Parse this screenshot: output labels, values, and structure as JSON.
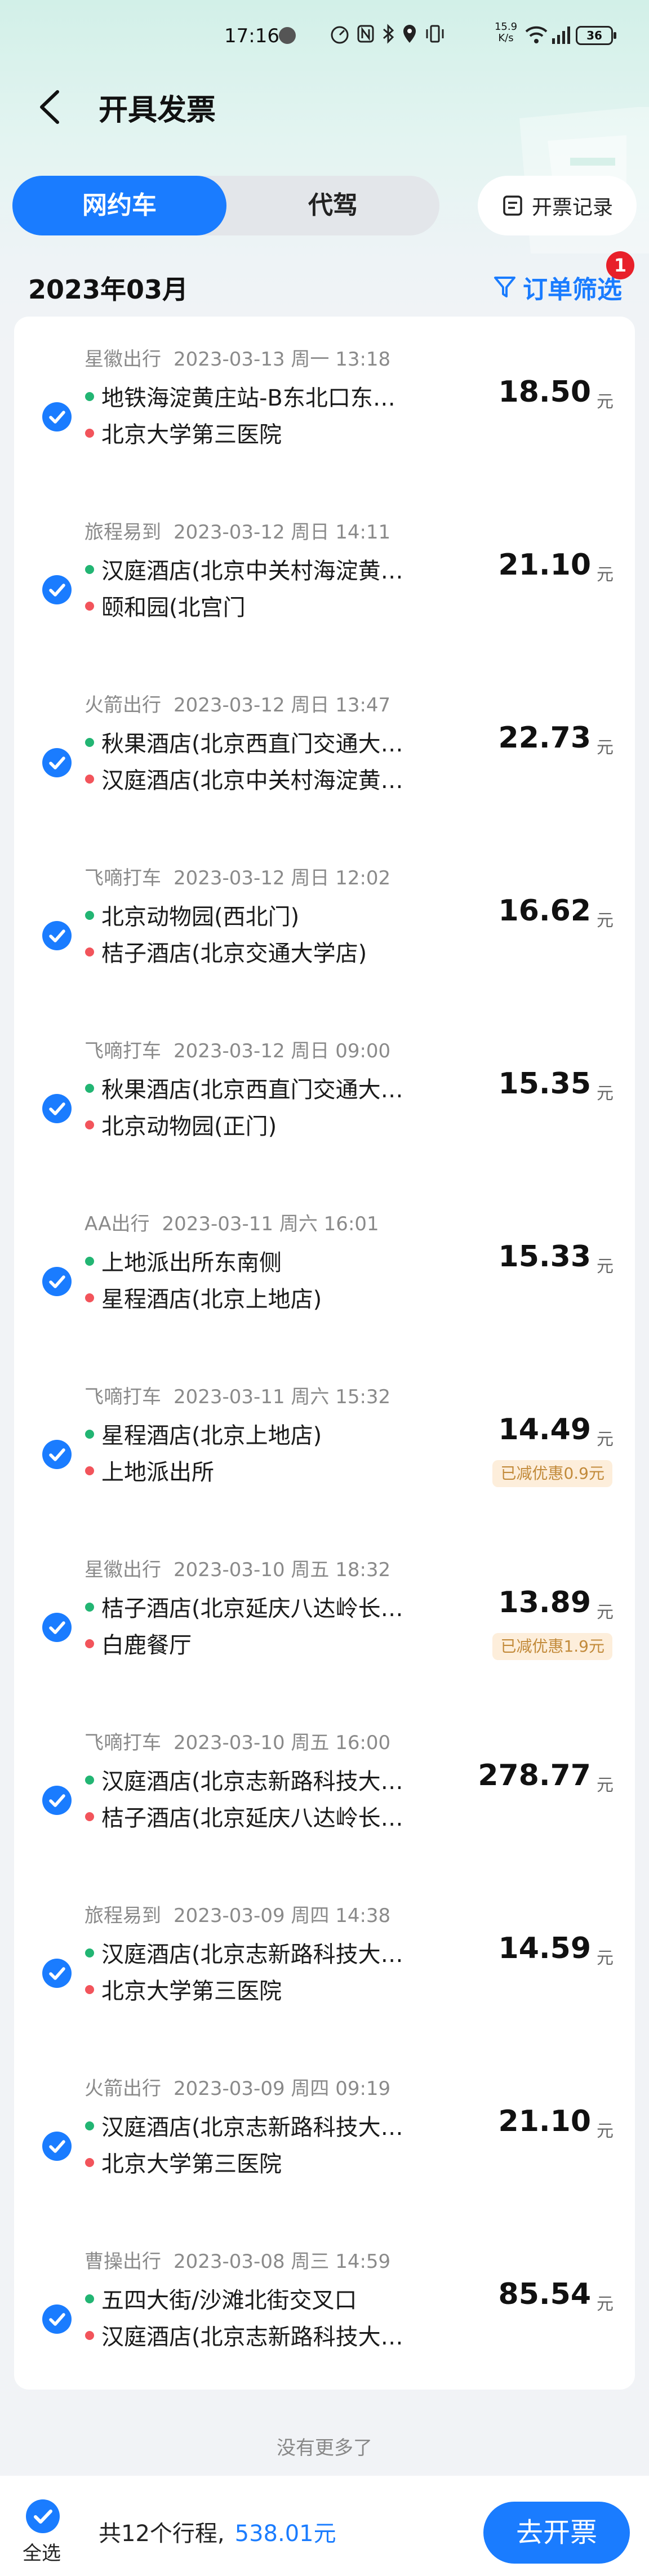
{
  "status_bar": {
    "time": "17:16",
    "net_speed_value": "15.9",
    "net_speed_unit": "K/s",
    "battery": "36"
  },
  "nav": {
    "title": "开具发票"
  },
  "tabs": [
    {
      "label": "网约车",
      "active": true
    },
    {
      "label": "代驾",
      "active": false
    }
  ],
  "invoice_records_label": "开票记录",
  "month": "2023年03月",
  "filter": {
    "label": "订单筛选",
    "badge": "1"
  },
  "trips": [
    {
      "provider": "星徽出行",
      "datetime": "2023-03-13 周一 13:18",
      "from": "地铁海淀黄庄站-B东北口东…",
      "to": "北京大学第三医院",
      "price": "18.50",
      "discount": ""
    },
    {
      "provider": "旅程易到",
      "datetime": "2023-03-12 周日 14:11",
      "from": "汉庭酒店(北京中关村海淀黄…",
      "to": "颐和园(北宫门",
      "price": "21.10",
      "discount": ""
    },
    {
      "provider": "火箭出行",
      "datetime": "2023-03-12 周日 13:47",
      "from": "秋果酒店(北京西直门交通大…",
      "to": "汉庭酒店(北京中关村海淀黄…",
      "price": "22.73",
      "discount": ""
    },
    {
      "provider": "飞嘀打车",
      "datetime": "2023-03-12 周日 12:02",
      "from": "北京动物园(西北门)",
      "to": "桔子酒店(北京交通大学店)",
      "price": "16.62",
      "discount": ""
    },
    {
      "provider": "飞嘀打车",
      "datetime": "2023-03-12 周日 09:00",
      "from": "秋果酒店(北京西直门交通大…",
      "to": "北京动物园(正门)",
      "price": "15.35",
      "discount": ""
    },
    {
      "provider": "AA出行",
      "datetime": "2023-03-11 周六 16:01",
      "from": "上地派出所东南侧",
      "to": "星程酒店(北京上地店)",
      "price": "15.33",
      "discount": ""
    },
    {
      "provider": "飞嘀打车",
      "datetime": "2023-03-11 周六 15:32",
      "from": "星程酒店(北京上地店)",
      "to": "上地派出所",
      "price": "14.49",
      "discount": "已减优惠0.9元"
    },
    {
      "provider": "星徽出行",
      "datetime": "2023-03-10 周五 18:32",
      "from": "桔子酒店(北京延庆八达岭长…",
      "to": "白鹿餐厅",
      "price": "13.89",
      "discount": "已减优惠1.9元"
    },
    {
      "provider": "飞嘀打车",
      "datetime": "2023-03-10 周五 16:00",
      "from": "汉庭酒店(北京志新路科技大…",
      "to": "桔子酒店(北京延庆八达岭长…",
      "price": "278.77",
      "discount": ""
    },
    {
      "provider": "旅程易到",
      "datetime": "2023-03-09 周四 14:38",
      "from": "汉庭酒店(北京志新路科技大…",
      "to": "北京大学第三医院",
      "price": "14.59",
      "discount": ""
    },
    {
      "provider": "火箭出行",
      "datetime": "2023-03-09 周四 09:19",
      "from": "汉庭酒店(北京志新路科技大…",
      "to": "北京大学第三医院",
      "price": "21.10",
      "discount": ""
    },
    {
      "provider": "曹操出行",
      "datetime": "2023-03-08 周三 14:59",
      "from": "五四大街/沙滩北街交叉口",
      "to": "汉庭酒店(北京志新路科技大…",
      "price": "85.54",
      "discount": ""
    }
  ],
  "price_unit": "元",
  "no_more": "没有更多了",
  "bottom": {
    "select_all": "全选",
    "summary": "共12个行程,",
    "amount": "538.01元",
    "submit": "去开票"
  },
  "colors": {
    "accent": "#1a7cff",
    "origin_dot": "#22b573",
    "dest_dot": "#f2545b",
    "badge": "#e8202a"
  }
}
